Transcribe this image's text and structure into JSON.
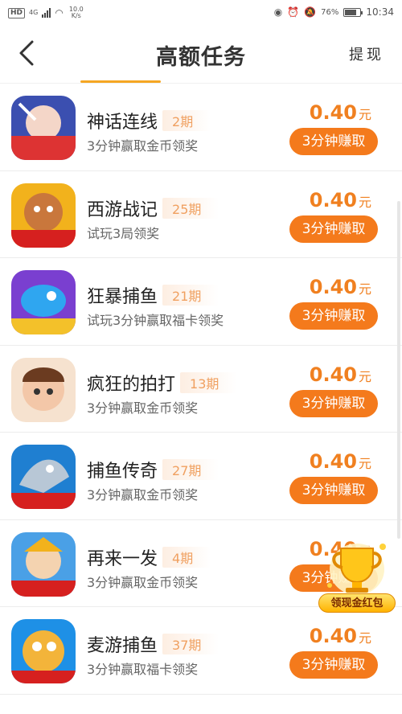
{
  "status_bar": {
    "hd": "HD",
    "network": "4G",
    "speed": "10.0 K/s",
    "battery": "76%",
    "time": "10:34"
  },
  "header": {
    "title": "高额任务",
    "withdraw_label": "提现"
  },
  "tasks": [
    {
      "name": "神话连线",
      "issue": "2期",
      "desc": "3分钟赢取金币领奖",
      "reward": "0.40",
      "unit": "元",
      "button": "3分钟赚取",
      "icon": "myth-link-game-icon"
    },
    {
      "name": "西游战记",
      "issue": "25期",
      "desc": "试玩3局领奖",
      "reward": "0.40",
      "unit": "元",
      "button": "3分钟赚取",
      "icon": "journey-west-game-icon"
    },
    {
      "name": "狂暴捕鱼",
      "issue": "21期",
      "desc": "试玩3分钟赢取福卡领奖",
      "reward": "0.40",
      "unit": "元",
      "button": "3分钟赚取",
      "icon": "fishing-game-icon"
    },
    {
      "name": "疯狂的拍打",
      "issue": "13期",
      "desc": "3分钟赢取金币领奖",
      "reward": "0.40",
      "unit": "元",
      "button": "3分钟赚取",
      "icon": "crazy-slap-game-icon"
    },
    {
      "name": "捕鱼传奇",
      "issue": "27期",
      "desc": "3分钟赢取金币领奖",
      "reward": "0.40",
      "unit": "元",
      "button": "3分钟赚取",
      "icon": "shark-fishing-game-icon"
    },
    {
      "name": "再来一发",
      "issue": "4期",
      "desc": "3分钟赢取金币领奖",
      "reward": "0.40",
      "unit": "元",
      "button": "3分钟赚取",
      "icon": "warrior-game-icon"
    },
    {
      "name": "麦游捕鱼",
      "issue": "37期",
      "desc": "3分钟赢取福卡领奖",
      "reward": "0.40",
      "unit": "元",
      "button": "3分钟赚取",
      "icon": "pufferfish-game-icon"
    }
  ],
  "float_widget": {
    "label": "领现金红包",
    "icon": "trophy-icon"
  },
  "colors": {
    "accent": "#f47a1c",
    "reward_text": "#f08020",
    "issue_text": "#f0a060",
    "tab_indicator": "#f5a623"
  }
}
